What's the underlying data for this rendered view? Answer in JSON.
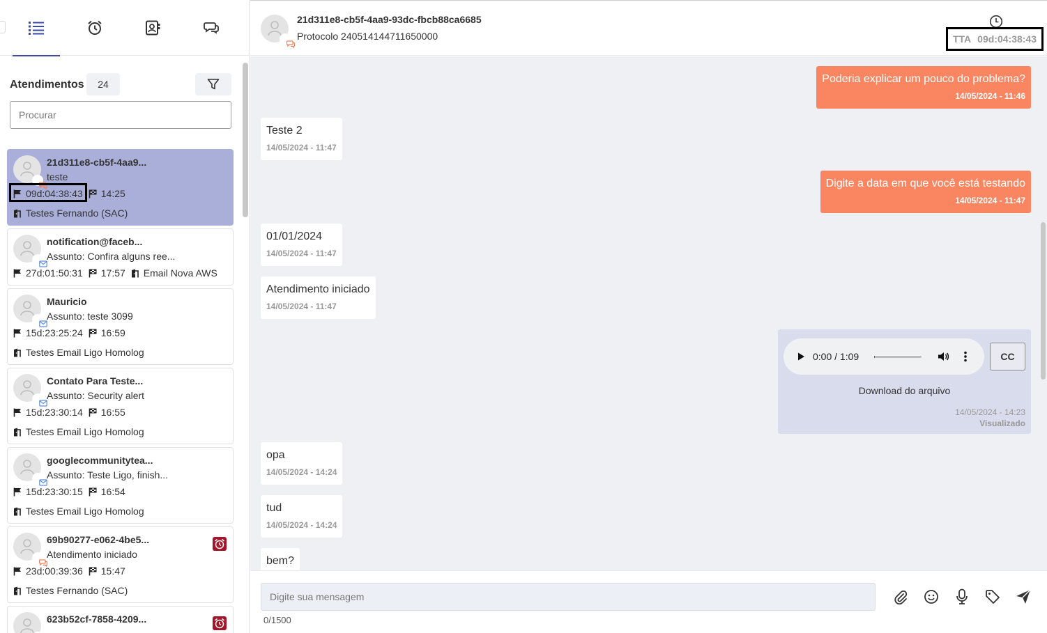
{
  "tabs": [
    {
      "name": "list-icon",
      "active": true
    },
    {
      "name": "alarm-clock-icon",
      "active": false
    },
    {
      "name": "contacts-icon",
      "active": false
    },
    {
      "name": "chat-bubbles-icon",
      "active": false
    }
  ],
  "list": {
    "title": "Atendimentos",
    "count": "24",
    "search_placeholder": "Procurar",
    "cards": [
      {
        "name": "21d311e8-cb5f-4aa9...",
        "subtitle": "teste",
        "elapsed": "09d:04:38:43",
        "time": "14:25",
        "queue": "Testes Fernando (SAC)",
        "channel": "chat",
        "alarm": false,
        "selected": true
      },
      {
        "name": "notification@faceb...",
        "subtitle": "Assunto: Confira alguns ree...",
        "elapsed": "27d:01:50:31",
        "time": "17:57",
        "queue": "Email Nova AWS",
        "channel": "email",
        "alarm": false,
        "selected": false
      },
      {
        "name": "Mauricio",
        "subtitle": "Assunto: teste 3099",
        "elapsed": "15d:23:25:24",
        "time": "16:59",
        "queue": "Testes Email Ligo Homolog",
        "channel": "email",
        "alarm": false,
        "selected": false
      },
      {
        "name": "Contato Para Teste...",
        "subtitle": "Assunto: Security alert",
        "elapsed": "15d:23:30:14",
        "time": "16:55",
        "queue": "Testes Email Ligo Homolog",
        "channel": "email",
        "alarm": false,
        "selected": false
      },
      {
        "name": "googlecommunitytea...",
        "subtitle": "Assunto: Teste Ligo, finish...",
        "elapsed": "15d:23:30:15",
        "time": "16:54",
        "queue": "Testes Email Ligo Homolog",
        "channel": "email",
        "alarm": false,
        "selected": false
      },
      {
        "name": "69b90277-e062-4be5...",
        "subtitle": "Atendimento iniciado",
        "elapsed": "23d:00:39:36",
        "time": "15:47",
        "queue": "Testes Fernando (SAC)",
        "channel": "chat",
        "alarm": true,
        "selected": false
      },
      {
        "name": "623b52cf-7858-4209...",
        "subtitle": "",
        "elapsed": "",
        "time": "",
        "queue": "",
        "channel": "chat",
        "alarm": true,
        "selected": false
      }
    ]
  },
  "header": {
    "name": "21d311e8-cb5f-4aa9-93dc-fbcb88ca6685",
    "protocol": "Protocolo 240514144711650000",
    "tta_label": "TTA",
    "tta_value": "09d:04:38:43"
  },
  "messages": [
    {
      "dir": "out",
      "text": "Poderia explicar um pouco do problema?",
      "ts": "14/05/2024 - 11:46"
    },
    {
      "dir": "in",
      "text": "Teste 2",
      "ts": "14/05/2024 - 11:47"
    },
    {
      "dir": "out",
      "text": "Digite a data em que você está testando",
      "ts": "14/05/2024 - 11:47"
    },
    {
      "dir": "in",
      "text": "01/01/2024",
      "ts": "14/05/2024 - 11:47"
    },
    {
      "dir": "in",
      "text": "Atendimento iniciado",
      "ts": "14/05/2024 - 11:47"
    },
    {
      "dir": "in",
      "text": "opa",
      "ts": "14/05/2024 - 14:24"
    },
    {
      "dir": "in",
      "text": "tud",
      "ts": "14/05/2024 - 14:24"
    },
    {
      "dir": "in",
      "text": "bem?",
      "ts": ""
    }
  ],
  "audio": {
    "time_display": "0:00 / 1:09",
    "progress": 0.02,
    "cc_label": "CC",
    "download_label": "Download do arquivo",
    "ts": "14/05/2024 - 14:23",
    "status": "Visualizado"
  },
  "composer": {
    "placeholder": "Digite sua mensagem",
    "char_count": "0/1500"
  },
  "colors": {
    "accent": "#3b4aa8",
    "selected_card": "#a9afd9",
    "outgoing_bubble": "#f98561",
    "alarm": "#a3162a",
    "chat_bg": "#eef0f4"
  }
}
